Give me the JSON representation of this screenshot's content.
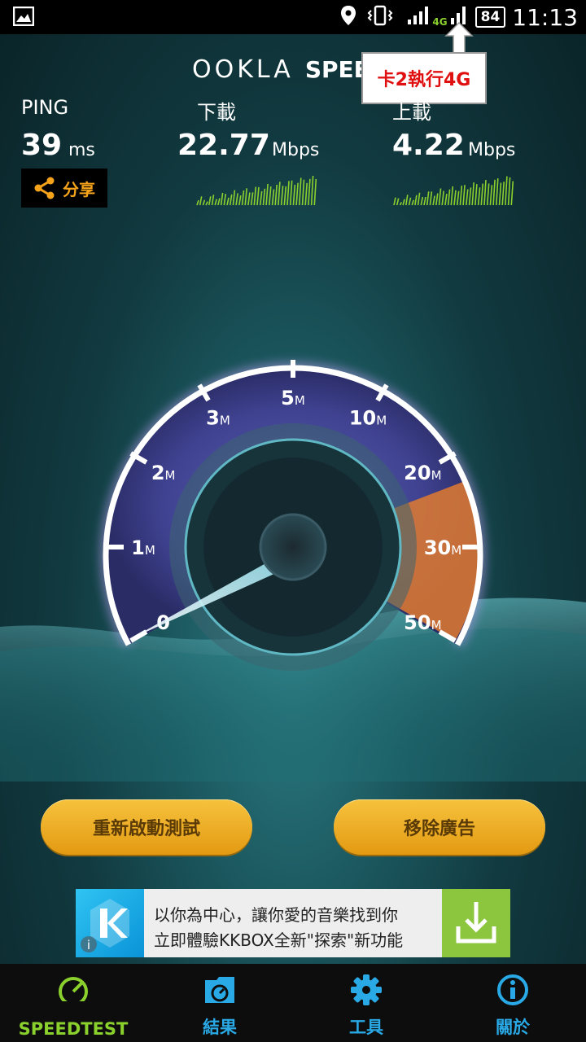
{
  "status_bar": {
    "network_type": "4G",
    "battery": "84",
    "time": "11:13"
  },
  "app": {
    "logo_part1": "OOKLA",
    "logo_part2": "SPEEDT"
  },
  "annotation": {
    "text": "卡2執行4G"
  },
  "results": {
    "ping": {
      "label": "PING",
      "value": "39",
      "unit": "ms"
    },
    "download": {
      "label": "下載",
      "value": "22.77",
      "unit": "Mbps"
    },
    "upload": {
      "label": "上載",
      "value": "4.22",
      "unit": "Mbps"
    },
    "share_label": "分享"
  },
  "gauge": {
    "ticks": [
      {
        "label": "0",
        "unit": ""
      },
      {
        "label": "1",
        "unit": "M"
      },
      {
        "label": "2",
        "unit": "M"
      },
      {
        "label": "3",
        "unit": "M"
      },
      {
        "label": "5",
        "unit": "M"
      },
      {
        "label": "10",
        "unit": "M"
      },
      {
        "label": "20",
        "unit": "M"
      },
      {
        "label": "30",
        "unit": "M"
      },
      {
        "label": "50",
        "unit": "M"
      }
    ]
  },
  "buttons": {
    "restart": "重新啟動測試",
    "remove_ads": "移除廣告"
  },
  "ad": {
    "line1": "以你為中心，讓你愛的音樂找到你",
    "line2": "立即體驗KKBOX全新\"探索\"新功能"
  },
  "nav": {
    "items": [
      {
        "label": "SPEEDTEST",
        "color": "#8bd12e"
      },
      {
        "label": "結果",
        "color": "#29a9e6"
      },
      {
        "label": "工具",
        "color": "#29a9e6"
      },
      {
        "label": "關於",
        "color": "#29a9e6"
      }
    ]
  },
  "colors": {
    "accent_green": "#8bd12e",
    "accent_blue": "#29a9e6",
    "button_gold": "#f0b02a",
    "share_orange": "#f5a31a",
    "annotation_red": "#e01010"
  }
}
